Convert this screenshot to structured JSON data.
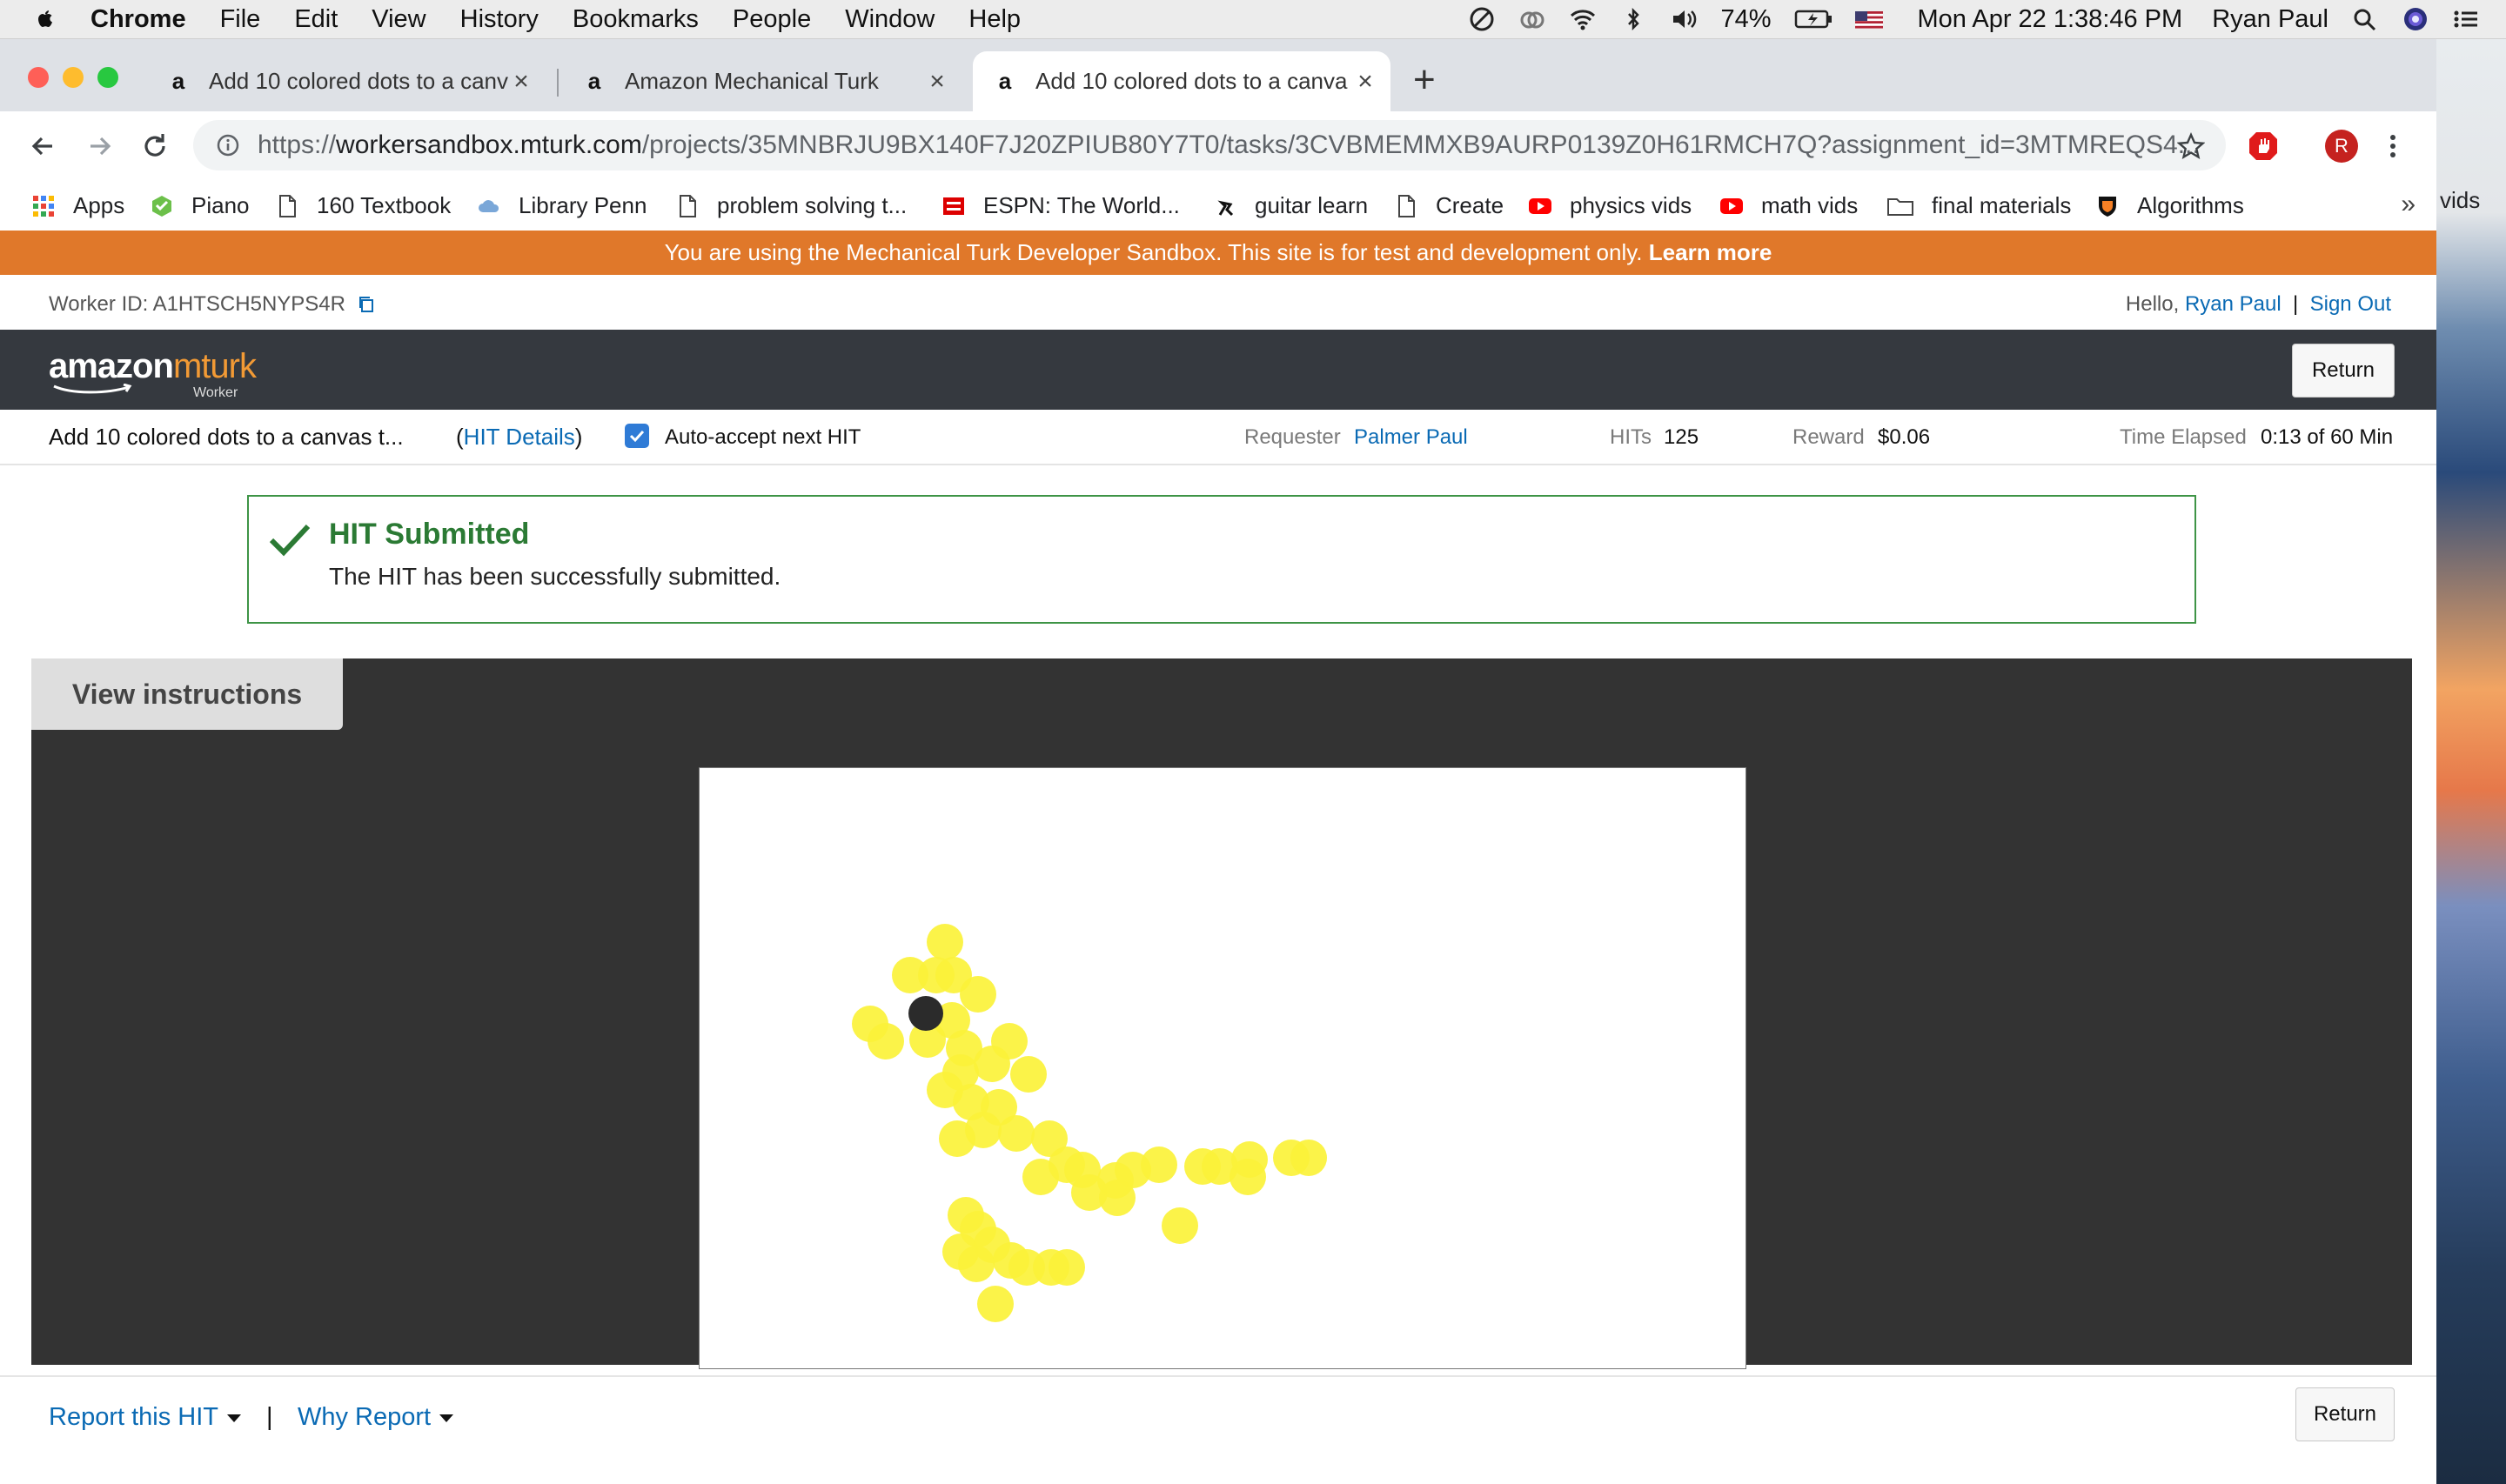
{
  "menubar": {
    "app_name": "Chrome",
    "items": [
      "File",
      "Edit",
      "View",
      "History",
      "Bookmarks",
      "People",
      "Window",
      "Help"
    ],
    "battery": "74%",
    "datetime": "Mon Apr 22  1:38:46 PM",
    "user": "Ryan Paul"
  },
  "tabs": [
    {
      "title": "Add 10 colored dots to a canva",
      "favicon": "a",
      "active": false
    },
    {
      "title": "Amazon Mechanical Turk",
      "favicon": "a",
      "active": false
    },
    {
      "title": "Add 10 colored dots to a canva",
      "favicon": "a",
      "active": true
    }
  ],
  "omnibox": {
    "scheme": "https://",
    "host": "workersandbox.mturk.com",
    "path": "/projects/35MNBRJU9BX140F7J20ZPIUB80Y7T0/tasks/3CVBMEMMXB9AURP0139Z0H61RMCH7Q?assignment_id=3MTMREQS4..."
  },
  "profile_initial": "R",
  "bookmarks": [
    "Apps",
    "Piano",
    "160 Textbook",
    "Library Penn",
    "problem solving t...",
    "ESPN: The World...",
    "guitar learn",
    "Create",
    "physics vids",
    "math vids",
    "final materials",
    "Algorithms"
  ],
  "bookmarks_overflow": "»",
  "desktop_peek_text": "vids",
  "sandbox_banner": {
    "text": "You are using the Mechanical Turk Developer Sandbox. This site is for test and development only.",
    "link": "Learn more"
  },
  "worker": {
    "id_label": "Worker ID: A1HTSCH5NYPS4R",
    "hello": "Hello,",
    "name": "Ryan Paul",
    "divider": "|",
    "sign_out": "Sign Out"
  },
  "header": {
    "logo_amazon": "amazon",
    "logo_mturk": "mturk",
    "logo_worker": "Worker",
    "return_label": "Return"
  },
  "hit": {
    "title": "Add 10 colored dots to a canvas t...",
    "details_open": "(",
    "details_link": "HIT Details",
    "details_close": ")",
    "auto_accept": "Auto-accept next HIT",
    "auto_accept_checked": true,
    "requester_label": "Requester",
    "requester": "Palmer Paul",
    "hits_label": "HITs",
    "hits": "125",
    "reward_label": "Reward",
    "reward": "$0.06",
    "time_label": "Time Elapsed",
    "time": "0:13 of 60 Min"
  },
  "alert": {
    "title": "HIT Submitted",
    "message": "The HIT has been successfully submitted."
  },
  "workspace": {
    "view_instructions": "View instructions",
    "dot_color": "#fbf23a",
    "cursor_color": "#2b2b2b"
  },
  "footer": {
    "report": "Report this HIT",
    "separator": "|",
    "why_report": "Why Report",
    "return_label": "Return"
  },
  "colors": {
    "sandbox_orange": "#e0782a",
    "header_dark": "#35393f",
    "link_blue": "#0a6ab4",
    "success_green": "#2b7a34"
  }
}
